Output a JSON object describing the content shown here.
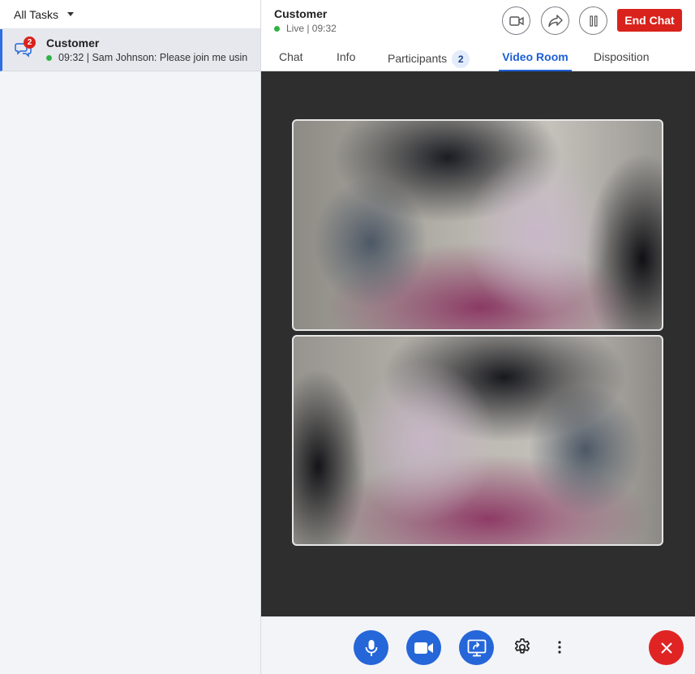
{
  "sidebar": {
    "filter_label": "All Tasks",
    "task": {
      "name": "Customer",
      "badge": "2",
      "preview": "09:32 | Sam Johnson: Please join me usin"
    }
  },
  "header": {
    "title": "Customer",
    "status": "Live | 09:32",
    "end_chat_label": "End Chat"
  },
  "tabs": [
    {
      "label": "Chat"
    },
    {
      "label": "Info"
    },
    {
      "label": "Participants",
      "count": "2"
    },
    {
      "label": "Video Room"
    },
    {
      "label": "Disposition"
    }
  ],
  "active_tab": "Video Room",
  "colors": {
    "accent": "#2566d8",
    "danger": "#d9221c",
    "live": "#2fb344"
  }
}
